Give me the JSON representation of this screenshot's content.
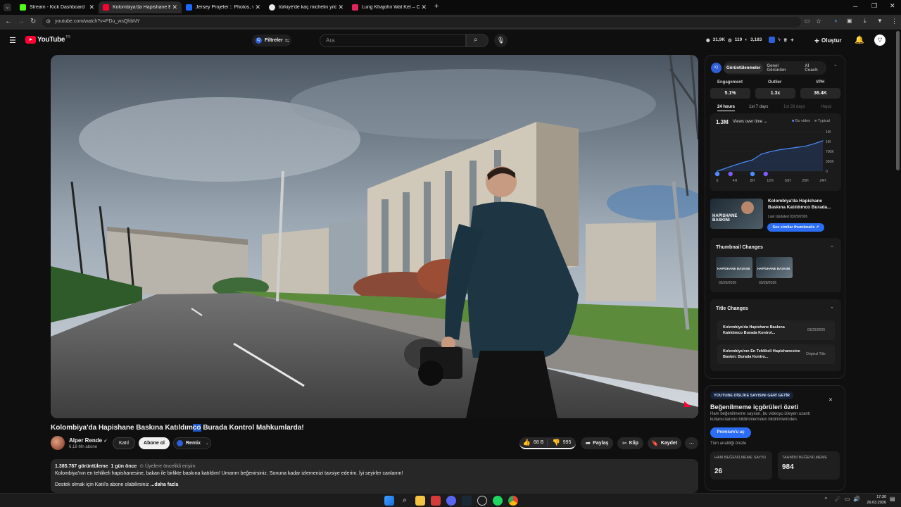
{
  "browser": {
    "tabs": [
      {
        "title": "Stream - Kick Dashboard",
        "color": "#53fc18"
      },
      {
        "title": "Kolombiya'da Hapishane Baskı",
        "color": "#ff0033"
      },
      {
        "title": "Jersey Projeler :: Photos, videos",
        "color": "#1769ff"
      },
      {
        "title": "türkiye'de kaç michelin yıldızlı",
        "color": "#e8e8e8"
      },
      {
        "title": "Lung Khajohn Wat Ket – Chiang",
        "color": "#e0245e"
      }
    ],
    "url": "youtube.com/watch?v=PDu_wsQhbNY"
  },
  "header": {
    "logo": "YouTube",
    "region": "TR",
    "filters_label": "Filtreler",
    "search_placeholder": "Ara",
    "stats": {
      "views": "31,9K",
      "videos": "119",
      "subs": "3,183"
    },
    "create_label": "Oluştur"
  },
  "video": {
    "title_before": "Kolombiya'da Hapishane Baskına Katıldım",
    "title_highlight": "co",
    "title_after": " Burada Kontrol Mahkumlarda!",
    "channel": "Alper Rende",
    "subscribers": "6,18 Mn abone",
    "join_label": "Katıl",
    "subscribe_label": "Abone ol",
    "remix_label": "Remix",
    "likes": "68 B",
    "dislikes": "995",
    "share_label": "Paylaş",
    "clip_label": "Klip",
    "save_label": "Kaydet",
    "views": "1.385.787 görüntüleme",
    "age": "1 gün önce",
    "members_first": "Üyelere öncelikli erişim",
    "desc_line1": "Kolombiya'nın en tehlikeli hapishanesine, bakan ile birlikte baskına katıldım! Umarım beğenirsiniz. Sonuna kadar izlemenizi tavsiye ederim. İyi seyirler canlarım!",
    "desc_line2": "Destek olmak için Katıl'a abone olabilirsiniz",
    "more_label": "...daha fazla"
  },
  "panel": {
    "tabs": [
      "Görüntülenmeler",
      "Genel Görünüm",
      "AI Coach"
    ],
    "metrics": [
      {
        "label": "Engagement",
        "value": "5.1%"
      },
      {
        "label": "Outlier",
        "value": "1.3x"
      },
      {
        "label": "VPH",
        "value": "36.4K"
      }
    ],
    "ranges": [
      "24 hours",
      "1st 7 days",
      "1st 28 days",
      "Hepsi"
    ],
    "total_views": "1.3M",
    "metric_select": "Views over time",
    "legend_this": "Bu video",
    "legend_typical": "Typical",
    "thumb_title": "Kolombiya'da Hapishane Baskına Katıldımco Burada...",
    "thumb_updated": "Last Updated 03/29/2026",
    "thumb_button": "See similar thumbnails",
    "thumb_overlay": "HAPİSHANE BASKINI",
    "thumbnail_changes_title": "Thumbnail Changes",
    "thumbnail_changes": [
      {
        "date": "03/29/2026"
      },
      {
        "date": "03/28/2026"
      }
    ],
    "title_changes_title": "Title Changes",
    "title_changes": [
      {
        "title": "Kolombiya'da Hapishane Baskına Katıldımco Burada Kontrol...",
        "date": "03/29/2026"
      },
      {
        "title": "Kolombiya'nın En Tehlikeli Hapishanesine Baskın: Burada Kontro...",
        "date": "Original Title"
      }
    ]
  },
  "chart_data": {
    "type": "line",
    "x": [
      "0",
      "4H",
      "8H",
      "12H",
      "16H",
      "20H",
      "24H"
    ],
    "y_ticks": [
      "1M",
      "1M",
      "700K",
      "350K",
      "0"
    ],
    "series": [
      {
        "name": "Bu video",
        "x": [
          0,
          2,
          4,
          6,
          8,
          10,
          12,
          14,
          16,
          18,
          20,
          22,
          24
        ],
        "values": [
          0,
          100000,
          200000,
          290000,
          370000,
          560000,
          640000,
          700000,
          740000,
          780000,
          820000,
          900000,
          1000000
        ]
      }
    ],
    "ylim": [
      0,
      1300000
    ]
  },
  "dislike_card": {
    "badge": "YOUTUBE DİSLİKE SAYISINI GERİ GETİR",
    "title": "Beğenilmeme içgörüleri özeti",
    "body": "Ham beğenilmeme sayıları, bu videoyu izleyen uzantı kullanıcılarının bildirimlerinden bildirimlerinden.",
    "button": "Premium'u aç",
    "preview_link": "Tüm analitiği önizle",
    "raw_label": "HAM BEĞENİLMEME SAYISI",
    "raw_value": "26",
    "est_label": "TAHMİNİ BEĞENİLMEME",
    "est_value": "984"
  },
  "taskbar": {
    "time": "17:30",
    "date": "29.03.2026"
  }
}
